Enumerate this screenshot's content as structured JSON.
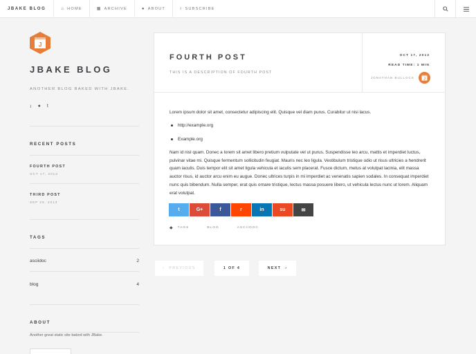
{
  "nav": {
    "brand": "JBAKE BLOG",
    "links": [
      {
        "icon": "home-icon",
        "glyph": "⌂",
        "label": "HOME"
      },
      {
        "icon": "archive-icon",
        "glyph": "▦",
        "label": "ARCHIVE"
      },
      {
        "icon": "user-icon",
        "glyph": "●",
        "label": "ABOUT"
      },
      {
        "icon": "rss-icon",
        "glyph": "≀",
        "label": "SUBSCRIBE"
      }
    ]
  },
  "sidebar": {
    "title": "JBAKE BLOG",
    "description": "ANOTHER BLOG BAKED WITH JBAKE.",
    "recent_heading": "RECENT POSTS",
    "recent_posts": [
      {
        "title": "FOURTH POST",
        "date": "OCT 17, 2013"
      },
      {
        "title": "THIRD POST",
        "date": "SEP 26, 2013"
      }
    ],
    "tags_heading": "TAGS",
    "tags": [
      {
        "name": "asciidoc",
        "count": "2"
      },
      {
        "name": "blog",
        "count": "4"
      }
    ],
    "about_heading": "ABOUT",
    "about_text": "Another great static site baked with JBake."
  },
  "article": {
    "title": "FOURTH POST",
    "description": "THIS IS A DESCRIPTION OF FOURTH POST",
    "date": "OCT 17, 2013",
    "read_time": "READ TIME: 1 MIN",
    "author": "JONATHAN BULLOCK",
    "intro": "Lorem ipsum dolor sit amet, consectetur adipiscing elit. Quisque vel diam purus. Curabitur ut nisi lacus.",
    "list": [
      "http://example.org",
      "Example.org"
    ],
    "paragraph": "Nam id nisl quam. Donec a lorem sit amet libero pretium vulputate vel ut purus. Suspendisse leo arcu, mattis et imperdiet luctus, pulvinar vitae mi. Quisque fermentum sollicitudin feugiat. Mauris nec leo ligula. Vestibulum tristique odio ut risus ultricies a hendrerit quam iaculis. Duis tempor elit sit amet ligula vehicula et iaculis sem placerat. Fusce dictum, metus at volutpat lacinia, elit massa auctor risus, id auctor arcu enim eu augue. Donec ultrices turpis in mi imperdiet ac venenatis sapien sodales. In consequat imperdiet nunc quis bibendum. Nulla semper, erat quis ornare tristique, lectus massa posuere libero, ut vehicula lectus nunc ut lorem. Aliquam erat volutpat.",
    "share": [
      {
        "name": "twitter",
        "glyph": "t",
        "color": "#55acee"
      },
      {
        "name": "google-plus",
        "glyph": "G+",
        "color": "#dd4b39"
      },
      {
        "name": "facebook",
        "glyph": "f",
        "color": "#3b5998"
      },
      {
        "name": "reddit",
        "glyph": "r",
        "color": "#ff4500"
      },
      {
        "name": "linkedin",
        "glyph": "in",
        "color": "#0976b4"
      },
      {
        "name": "stumbleupon",
        "glyph": "su",
        "color": "#eb4924"
      },
      {
        "name": "email",
        "glyph": "✉",
        "color": "#444444"
      }
    ],
    "tags_label": "TAGS",
    "tags": [
      "BLOG",
      "ASCIIDOC"
    ]
  },
  "pagination": {
    "previous": "PREVIOUS",
    "page_info": "1 OF 4",
    "next": "NEXT"
  },
  "colors": {
    "accent": "#e67e3a",
    "background": "#f4f4f4"
  }
}
